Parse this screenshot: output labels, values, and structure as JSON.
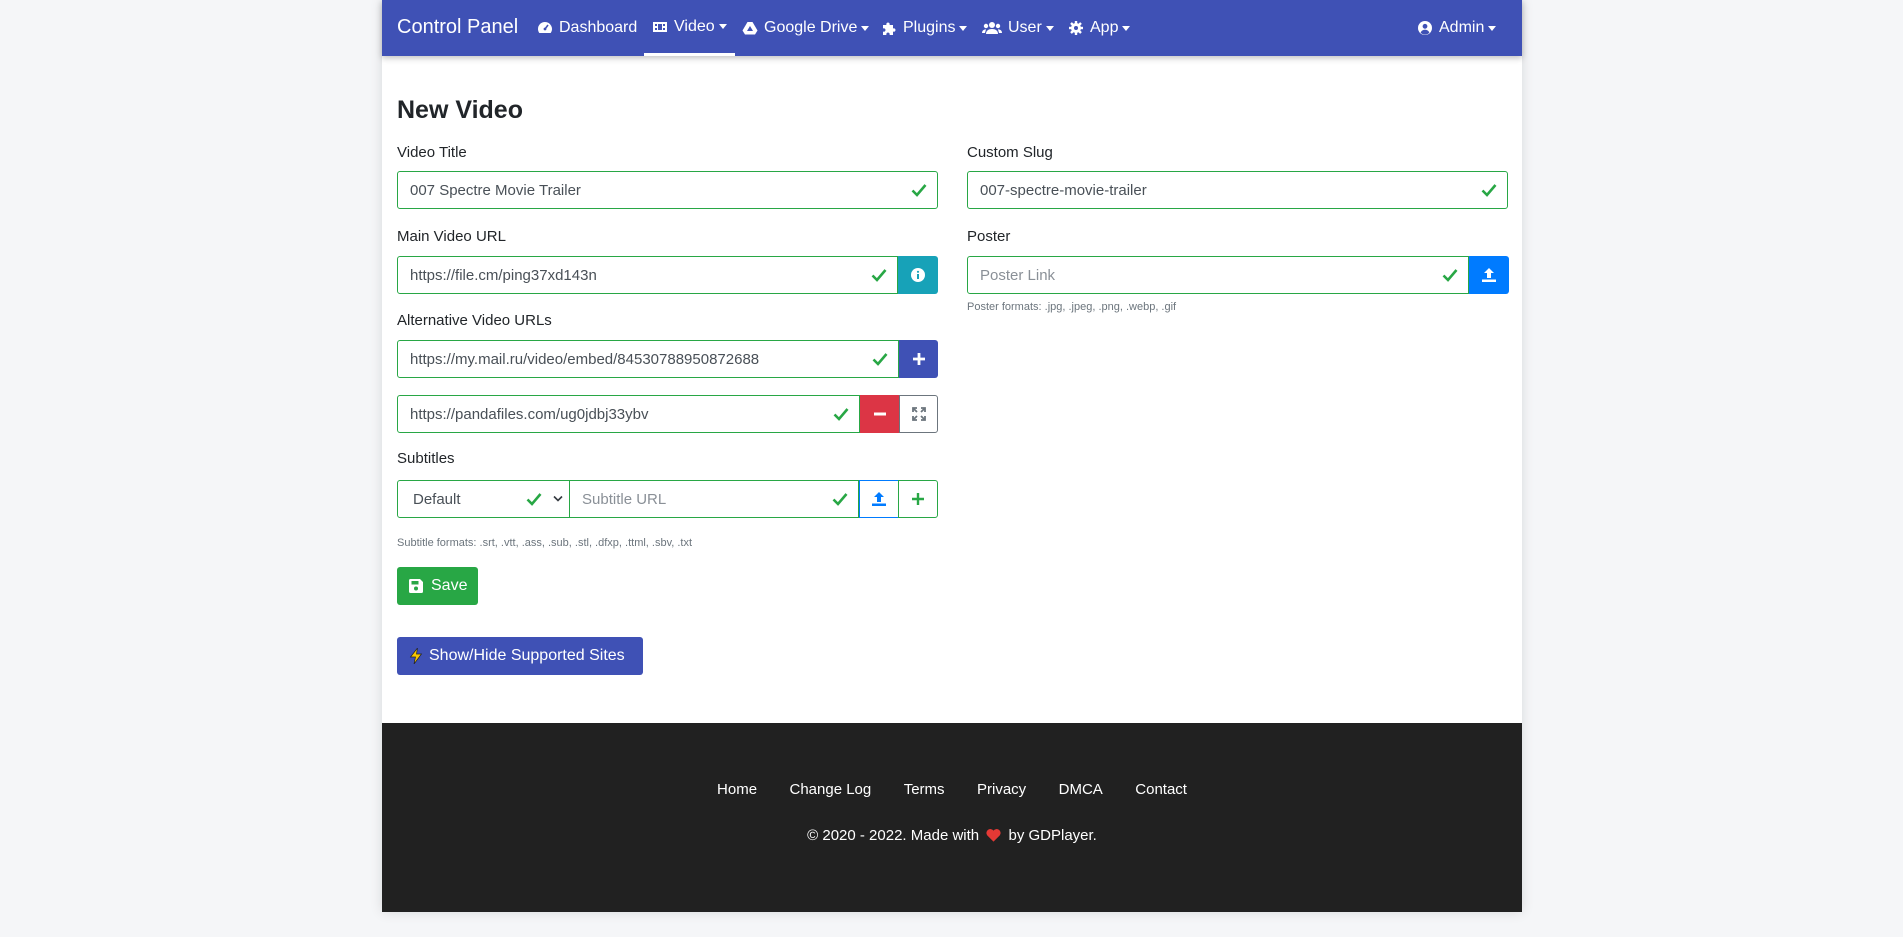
{
  "nav": {
    "brand": "Control Panel",
    "items": [
      {
        "label": "Dashboard",
        "icon": "dashboard-icon"
      },
      {
        "label": "Video",
        "icon": "film-icon"
      },
      {
        "label": "Google Drive",
        "icon": "google-drive-icon"
      },
      {
        "label": "Plugins",
        "icon": "puzzle-icon"
      },
      {
        "label": "User",
        "icon": "users-icon"
      },
      {
        "label": "App",
        "icon": "gear-icon"
      }
    ],
    "admin": "Admin"
  },
  "page": {
    "title": "New Video"
  },
  "form": {
    "video_title": {
      "label": "Video Title",
      "value": "007 Spectre Movie Trailer"
    },
    "custom_slug": {
      "label": "Custom Slug",
      "value": "007-spectre-movie-trailer"
    },
    "main_url": {
      "label": "Main Video URL",
      "value": "https://file.cm/ping37xd143n"
    },
    "poster": {
      "label": "Poster",
      "placeholder": "Poster Link",
      "help": "Poster formats: .jpg, .jpeg, .png, .webp, .gif"
    },
    "alt_urls": {
      "label": "Alternative Video URLs",
      "items": [
        "https://my.mail.ru/video/embed/84530788950872688",
        "https://pandafiles.com/ug0jdbj33ybv"
      ]
    },
    "subtitles": {
      "label": "Subtitles",
      "language": "Default",
      "placeholder": "Subtitle URL",
      "help": "Subtitle formats: .srt, .vtt, .ass, .sub, .stl, .dfxp, .ttml, .sbv, .txt"
    },
    "save_label": "Save",
    "supported_label": "Show/Hide Supported Sites"
  },
  "footer": {
    "links": [
      "Home",
      "Change Log",
      "Terms",
      "Privacy",
      "DMCA",
      "Contact"
    ],
    "copy_prefix": "© 2020 - 2022. Made with",
    "copy_suffix": "by GDPlayer."
  },
  "colors": {
    "primary": "#3f51b5",
    "success": "#28a745",
    "danger": "#dc3545",
    "info": "#17a2b8",
    "blue": "#007bff"
  }
}
